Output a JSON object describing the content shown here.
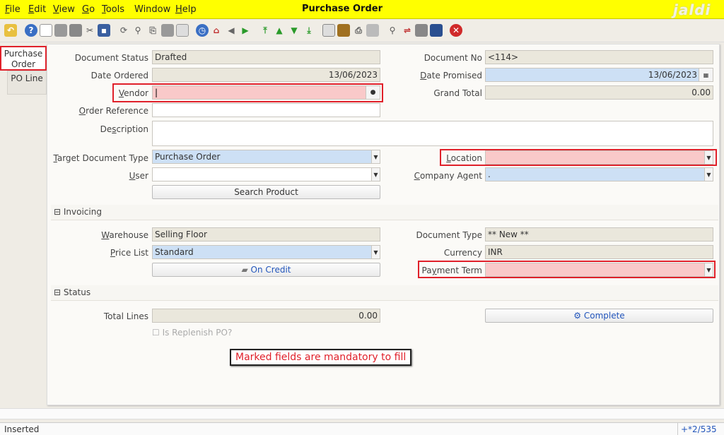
{
  "window": {
    "title": "Purchase Order",
    "logo": "jaldi"
  },
  "menu": [
    {
      "underline": "F",
      "rest": "ile"
    },
    {
      "underline": "E",
      "rest": "dit"
    },
    {
      "underline": "V",
      "rest": "iew"
    },
    {
      "underline": "G",
      "rest": "o"
    },
    {
      "underline": "T",
      "rest": "ools"
    },
    {
      "underline": "",
      "rest": "Window"
    },
    {
      "underline": "H",
      "rest": "elp"
    }
  ],
  "toolbar": {
    "icons": [
      "undo-icon",
      "help-icon",
      "new-record-icon",
      "copy-icon",
      "delete-icon",
      "delete-selection-icon",
      "save-icon",
      "refresh-icon",
      "find-icon",
      "attachment-icon",
      "chat-icon",
      "history-icon",
      "home-icon",
      "back-icon",
      "forward-icon",
      "first-record-icon",
      "previous-record-icon",
      "next-record-icon",
      "last-record-icon",
      "report-icon",
      "archive-icon",
      "print-icon",
      "print-preview-icon",
      "zoom-across-icon",
      "workflow-icon",
      "requests-icon",
      "product-info-icon",
      "close-window-icon"
    ]
  },
  "tabs": {
    "active": "Purchase Order",
    "second": "PO Line"
  },
  "form": {
    "document_status": {
      "label": "Document Status",
      "value": "Drafted"
    },
    "date_ordered": {
      "label": "Date Ordered",
      "value": "13/06/2023"
    },
    "vendor": {
      "label_u": "V",
      "label_rest": "endor",
      "value": ""
    },
    "order_reference": {
      "label_u": "O",
      "label_rest": "rder Reference",
      "value": ""
    },
    "description": {
      "label_pre": "De",
      "label_u": "s",
      "label_rest": "cription",
      "value": ""
    },
    "target_doc_type": {
      "label_u": "T",
      "label_rest": "arget Document Type",
      "value": "Purchase Order"
    },
    "user": {
      "label_u": "U",
      "label_rest": "ser",
      "value": ""
    },
    "search_product": "Search Product",
    "document_no": {
      "label": "Document No",
      "value": "<114>"
    },
    "date_promised": {
      "label_u": "D",
      "label_rest": "ate Promised",
      "value": "13/06/2023"
    },
    "grand_total": {
      "label": "Grand Total",
      "value": "0.00"
    },
    "location": {
      "label_u": "L",
      "label_rest": "ocation",
      "value": ""
    },
    "company_agent": {
      "label_u": "C",
      "label_rest": "ompany Agent",
      "value": "."
    }
  },
  "invoicing": {
    "header": "Invoicing",
    "warehouse": {
      "label_u": "W",
      "label_rest": "arehouse",
      "value": "Selling Floor"
    },
    "price_list": {
      "label_u": "P",
      "label_rest": "rice List",
      "value": "Standard"
    },
    "on_credit": "On Credit",
    "document_type": {
      "label": "Document Type",
      "value": "** New **"
    },
    "currency": {
      "label": "Currency",
      "value": "INR"
    },
    "payment_term": {
      "label_pre": "Pa",
      "label_u": "y",
      "label_rest": "ment Term",
      "value": ""
    }
  },
  "status": {
    "header": "Status",
    "total_lines": {
      "label": "Total Lines",
      "value": "0.00"
    },
    "complete": "Complete",
    "is_replenish": "Is Replenish PO?"
  },
  "annotation": "Marked fields are mandatory to fill",
  "statusbar": {
    "text": "Inserted",
    "record": "+*2/535"
  }
}
